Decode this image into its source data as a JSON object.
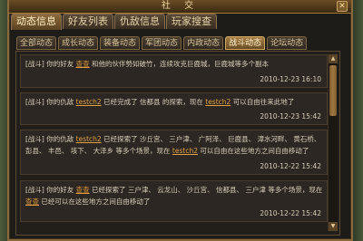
{
  "window": {
    "title": "社 交",
    "close_label": "✕"
  },
  "main_tabs": [
    {
      "label": "动态信息",
      "active": true
    },
    {
      "label": "好友列表",
      "active": false
    },
    {
      "label": "仇敌信息",
      "active": false
    },
    {
      "label": "玩家搜查",
      "active": false
    }
  ],
  "sub_tabs": [
    {
      "label": "全部动态",
      "active": false
    },
    {
      "label": "成长动态",
      "active": false
    },
    {
      "label": "装备动态",
      "active": false
    },
    {
      "label": "军团动态",
      "active": false
    },
    {
      "label": "内政动态",
      "active": false
    },
    {
      "label": "战斗动态",
      "active": true
    },
    {
      "label": "论坛动态",
      "active": false
    }
  ],
  "entries": [
    {
      "tag": "[战斗]",
      "p1": "你的好友 ",
      "name": "查查",
      "p2": " 和他的伙伴勢如破竹，连续攻克巨鹿城，巨鹿城等多个副本",
      "time": "2010-12-23 16:10"
    },
    {
      "tag": "[战斗]",
      "p1": "你的仇敌 ",
      "name": "testch2",
      "p2": " 已经完成了 信都县 的探索，现在 ",
      "name2": "testch2",
      "p3": " 可以自由往来此地了",
      "time": "2010-12-23 15:42"
    },
    {
      "tag": "[战斗]",
      "p1": "你的仇敌 ",
      "name": "testch2",
      "p2": " 已经探索了 沙丘宫、 三户津、 广阿泽、 巨鹿县、 漳水河畔、 黄石桥、 彭县、 丰邑、 垓下、 大泽乡 等多个场景，现在 ",
      "name2": "testch2",
      "p3": " 可以自由在这些地方之间自由移动了",
      "time": "2010-12-22 15:42"
    },
    {
      "tag": "[战斗]",
      "p1": "你的好友 ",
      "name": "查查",
      "p2": " 已经探索了 三户津、 云龙山、 沙丘宫、 信都县、 三户津 等多个场景，现在 ",
      "name2": "查查",
      "p3": " 已经可以在这些地方之间自由移动了",
      "time": "2010-12-22 15:42"
    }
  ],
  "scrollbar": {
    "up_icon": "▲",
    "down_icon": "▼"
  }
}
